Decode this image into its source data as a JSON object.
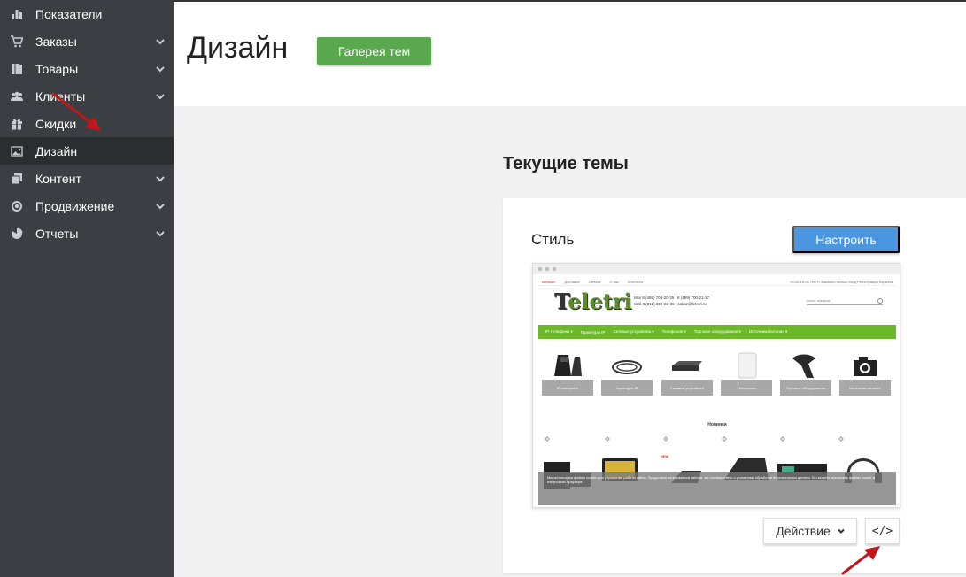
{
  "sidebar": {
    "items": [
      {
        "label": "Показатели",
        "icon": "bar-chart-icon",
        "has_chevron": false,
        "active": false
      },
      {
        "label": "Заказы",
        "icon": "cart-icon",
        "has_chevron": true,
        "active": false
      },
      {
        "label": "Товары",
        "icon": "books-icon",
        "has_chevron": true,
        "active": false
      },
      {
        "label": "Клиенты",
        "icon": "users-icon",
        "has_chevron": true,
        "active": false
      },
      {
        "label": "Скидки",
        "icon": "gift-icon",
        "has_chevron": false,
        "active": false
      },
      {
        "label": "Дизайн",
        "icon": "image-icon",
        "has_chevron": false,
        "active": true
      },
      {
        "label": "Контент",
        "icon": "pages-icon",
        "has_chevron": true,
        "active": false
      },
      {
        "label": "Продвижение",
        "icon": "target-icon",
        "has_chevron": true,
        "active": false
      },
      {
        "label": "Отчеты",
        "icon": "pie-chart-icon",
        "has_chevron": true,
        "active": false
      }
    ]
  },
  "header": {
    "title": "Дизайн",
    "gallery_button": "Галерея тем"
  },
  "main": {
    "section_title": "Текущие темы",
    "theme_card": {
      "label": "Стиль",
      "configure_button": "Настроить",
      "action_button": "Действие",
      "code_button": "</>"
    }
  },
  "preview": {
    "topbar_links": [
      "Магазин",
      "Доставка",
      "Оплата",
      "О нас",
      "Контакты"
    ],
    "topbar_right": "09:00-18:00 Пн-Пт   Заказать звонок   Вход   Регистрация   Корзина",
    "logo_first": "T",
    "logo_rest": "eletri",
    "phones": "Мск 8 (499) 704-20-35   8 (499) 700-21-17\nСпб 8 (812) 309-22-35   zakaz@teletri.ru",
    "search_placeholder": "поиск товаров",
    "nav_items": [
      "IP-телефоны ▾",
      "Гарнитуры IP",
      "Сетевые устройства ▾",
      "Телефония ▾",
      "Торговое оборудование ▾",
      "Источники питания ▾"
    ],
    "products": [
      "IP-телефоны",
      "Гарнитуры IP",
      "Сетевые устройства",
      "Телефония",
      "Торговое оборудование",
      "Источники питания"
    ],
    "novinki": "Новинки",
    "new_badge": "NEW",
    "cookie_text": "Мы используем файлы cookie для улучшения работы сайта. Продолжая пользоваться сайтом, вы соглашаетесь с условиями обработки персональных данных. Вы можете отключить файлы cookie в настройках браузера."
  },
  "colors": {
    "sidebar_bg": "#3b3f43",
    "sidebar_active": "#2b2e31",
    "gallery_btn": "#5aa84e",
    "configure_btn": "#4a97e0",
    "annotation_arrow": "#c0171b"
  }
}
